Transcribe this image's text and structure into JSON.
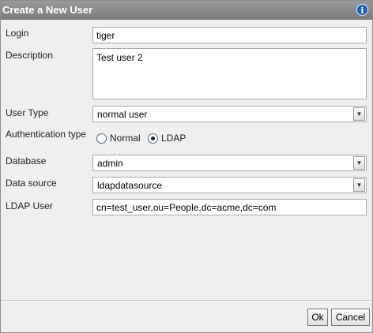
{
  "dialog": {
    "title": "Create a New User",
    "info_icon": "info-icon",
    "info_glyph": "i"
  },
  "form": {
    "login": {
      "label": "Login",
      "value": "tiger"
    },
    "description": {
      "label": "Description",
      "value": "Test user 2"
    },
    "user_type": {
      "label": "User Type",
      "value": "normal user"
    },
    "auth_type": {
      "label": "Authentication type",
      "options": [
        {
          "label": "Normal",
          "checked": false
        },
        {
          "label": "LDAP",
          "checked": true
        }
      ]
    },
    "database": {
      "label": "Database",
      "value": "admin"
    },
    "data_source": {
      "label": "Data source",
      "value": "ldapdatasource"
    },
    "ldap_user": {
      "label": "LDAP User",
      "value": "cn=test_user,ou=People,dc=acme,dc=com"
    }
  },
  "buttons": {
    "ok": "Ok",
    "cancel": "Cancel"
  },
  "glyphs": {
    "dropdown_arrow": "▼"
  }
}
